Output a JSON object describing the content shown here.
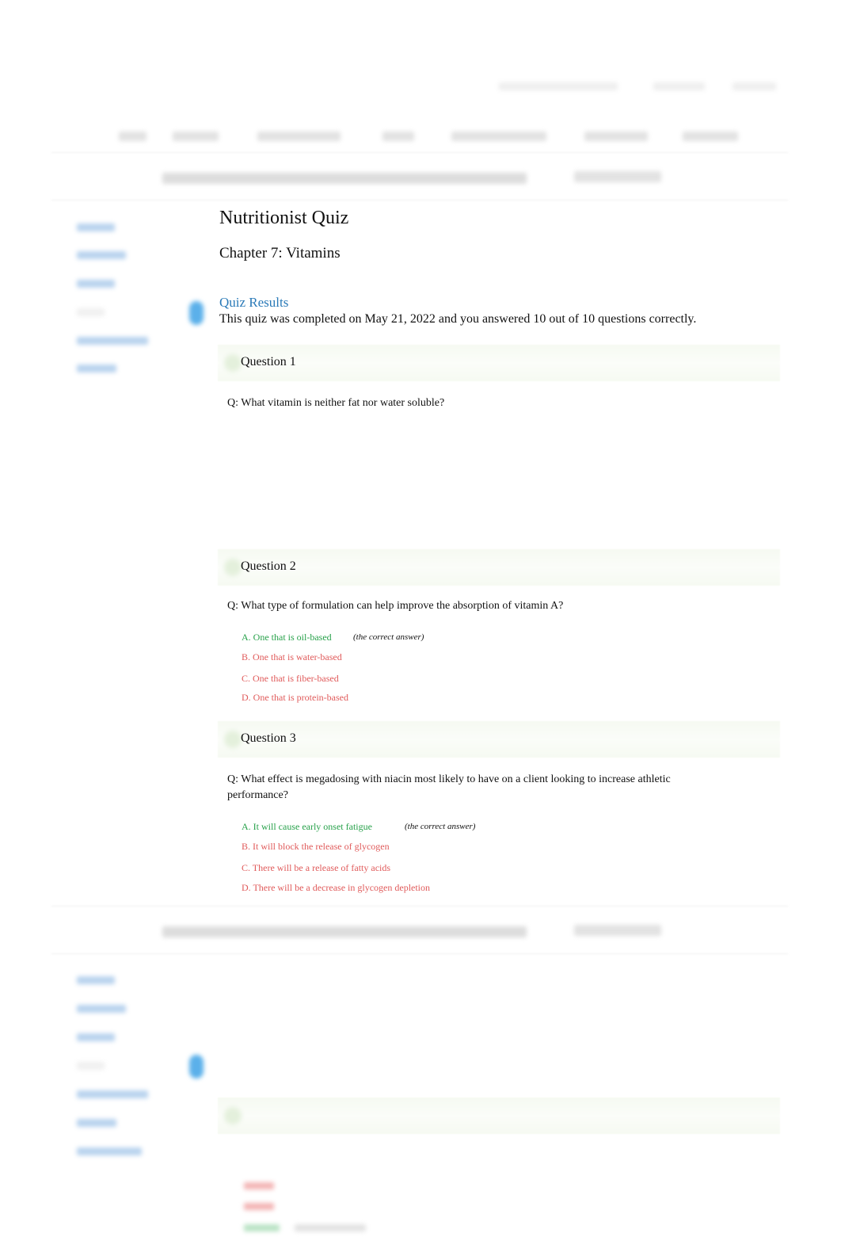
{
  "quiz": {
    "title": "Nutritionist Quiz",
    "chapter": "Chapter 7: Vitamins",
    "results_label": "Quiz Results",
    "summary": "This quiz was completed on May 21, 2022 and you answered 10 out of 10 questions correctly."
  },
  "questions": [
    {
      "label": "Question 1",
      "text": "Q:  What vitamin is neither fat nor water soluble?",
      "answers": []
    },
    {
      "label": "Question 2",
      "text": "Q:  What type of formulation can help improve the absorption of vitamin A?",
      "answers": [
        "A. One that is oil-based",
        "B. One that is water-based",
        "C. One that is fiber-based",
        "D. One that is protein-based"
      ],
      "correct_note": "(the correct answer)"
    },
    {
      "label": "Question 3",
      "text": "Q:  What effect is megadosing with niacin most likely to have on a client looking to increase athletic performance?",
      "answers": [
        "A. It will cause early onset fatigue",
        "B. It will block the release of glycogen",
        "C. There will be a release of fatty acids",
        "D. There will be a decrease in glycogen depletion"
      ],
      "correct_note": "(the correct answer)"
    }
  ],
  "colors": {
    "correct": "#27a14a",
    "incorrect": "#e05a5a",
    "link": "#2a7ab8"
  },
  "icons": {
    "side_arrow": "arrow-right-icon"
  }
}
